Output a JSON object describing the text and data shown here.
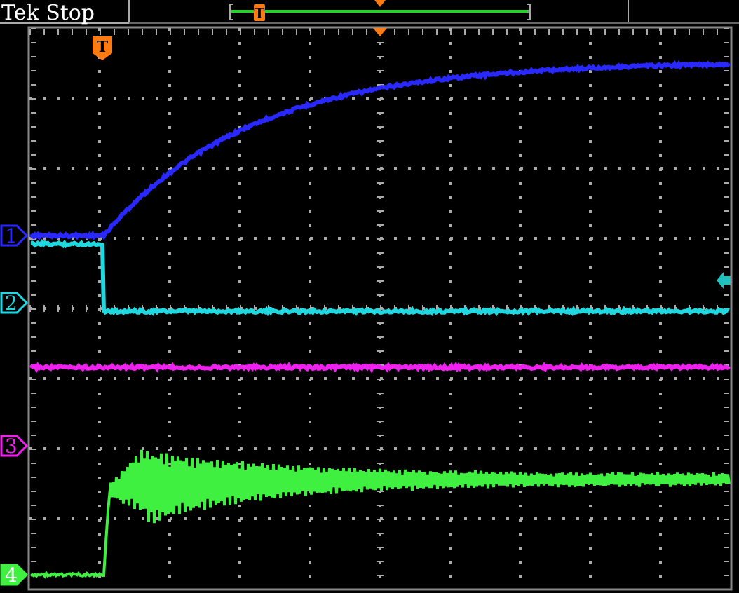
{
  "header": {
    "title": "Tek Stop"
  },
  "record_bar": {
    "trigger_label": "T"
  },
  "trigger_marker": {
    "label": "T"
  },
  "channels": [
    {
      "label": "1",
      "color": "#2828ff",
      "selected": false
    },
    {
      "label": "2",
      "color": "#20d8e0",
      "selected": false
    },
    {
      "label": "3",
      "color": "#f020f0",
      "selected": false
    },
    {
      "label": "4",
      "color": "#40f040",
      "selected": true
    }
  ]
}
